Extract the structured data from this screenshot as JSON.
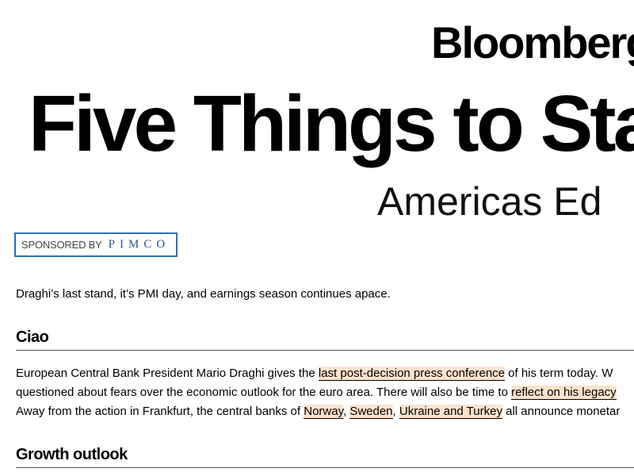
{
  "header": {
    "wordmark": "Bloomberg",
    "headline": "Five Things to Sta",
    "edition": "Americas Ed"
  },
  "sponsor": {
    "label": "SPONSORED BY",
    "brand": "PIMCO"
  },
  "intro": "Draghi’s last stand, it’s PMI day, and earnings season continues apace.",
  "sections": [
    {
      "title": "Ciao",
      "line1": {
        "pre": "European Central Bank President Mario Draghi gives the ",
        "link": "last post-decision press conference",
        "post": " of his term today. W"
      },
      "line2": {
        "pre": "questioned about fears over the economic outlook for the euro area. There will also be time to ",
        "link": "reflect on his legacy"
      },
      "line3": {
        "pre": "Away from the action in Frankfurt, the central banks of ",
        "link1": "Norway",
        "sep1": ", ",
        "link2": "Sweden",
        "sep2": ", ",
        "link3": "Ukraine and Turkey",
        "post": " all announce monetar"
      }
    },
    {
      "title": "Growth outlook"
    }
  ],
  "colors": {
    "link_highlight": "#fde3cd",
    "sponsor_border": "#2f6fb5",
    "sponsor_brand": "#2a4f8f"
  }
}
